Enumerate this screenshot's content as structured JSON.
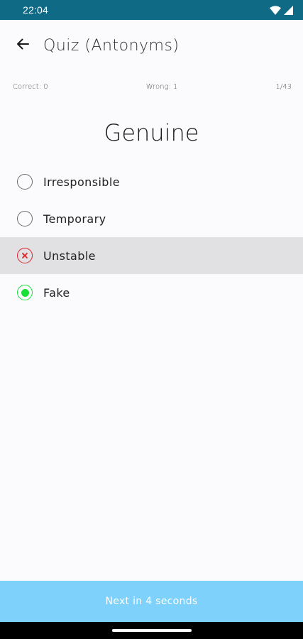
{
  "status_bar": {
    "time": "22:04"
  },
  "app_bar": {
    "title": "Quiz (Antonyms)"
  },
  "stats": {
    "correct": "Correct: 0",
    "wrong": "Wrong: 1",
    "progress": "1/43"
  },
  "question": {
    "word": "Genuine"
  },
  "options": [
    {
      "label": "Irresponsible",
      "state": "unselected"
    },
    {
      "label": "Temporary",
      "state": "unselected"
    },
    {
      "label": "Unstable",
      "state": "wrong"
    },
    {
      "label": "Fake",
      "state": "correct"
    }
  ],
  "next_button": {
    "label": "Next in 4 seconds"
  },
  "colors": {
    "status_bar": "#0f6a86",
    "wrong": "#e0212b",
    "correct": "#18e038",
    "next_bar": "#7dd1fb",
    "selected_row": "#e1e1e3"
  }
}
